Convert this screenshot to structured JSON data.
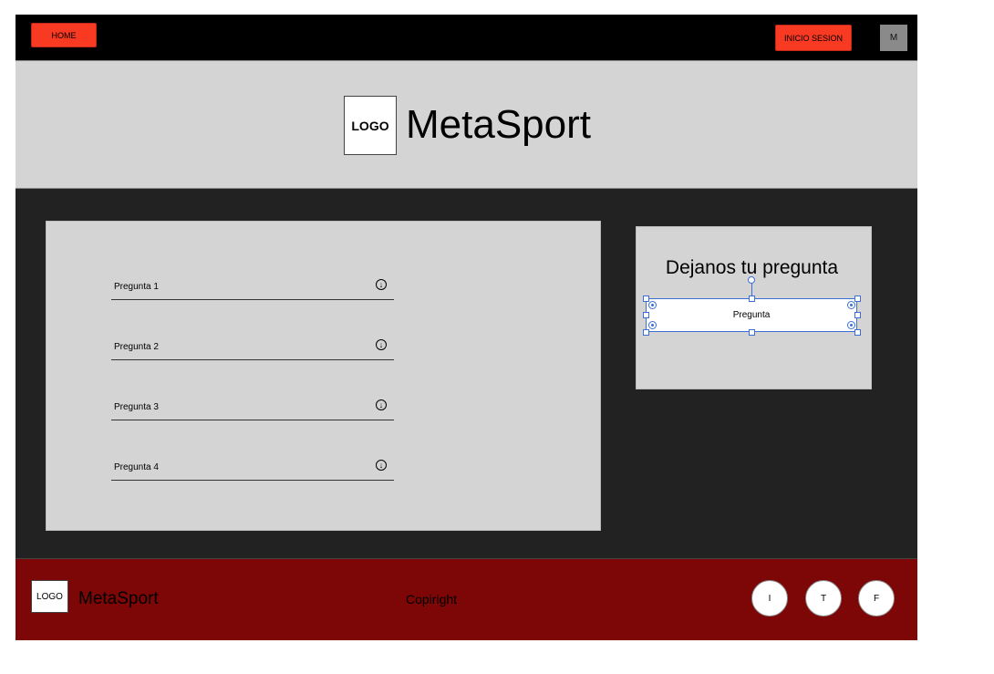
{
  "nav": {
    "home_label": "HOME",
    "login_label": "INICIO SESION",
    "user_label": "M"
  },
  "header": {
    "logo_label": "LOGO",
    "title": "MetaSport"
  },
  "faq": {
    "items": [
      {
        "label": "Pregunta 1"
      },
      {
        "label": "Pregunta 2"
      },
      {
        "label": "Pregunta 3"
      },
      {
        "label": "Pregunta 4"
      }
    ],
    "expand_glyph": "↓"
  },
  "ask": {
    "title": "Dejanos tu  pregunta",
    "input_label": "Pregunta"
  },
  "footer": {
    "logo_label": "LOGO",
    "title": "MetaSport",
    "copyright": "Copiright",
    "social": [
      {
        "label": "I"
      },
      {
        "label": "T"
      },
      {
        "label": "F"
      }
    ]
  },
  "colors": {
    "accent_red": "#f83a22",
    "top_bar": "#000000",
    "header_bg": "#d4d4d4",
    "main_bg": "#222222",
    "footer_bg": "#7d0606",
    "selection_blue": "#3b6fd4"
  }
}
